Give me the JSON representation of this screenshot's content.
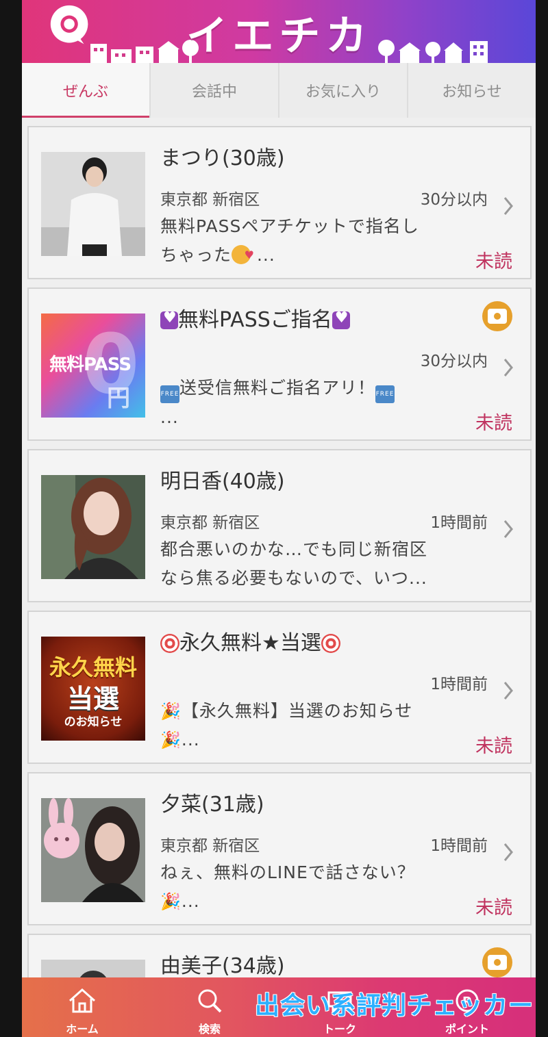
{
  "app": {
    "title": "イエチカ"
  },
  "tabs": [
    {
      "label": "ぜんぶ",
      "active": true
    },
    {
      "label": "会話中",
      "active": false
    },
    {
      "label": "お気に入り",
      "active": false
    },
    {
      "label": "お知らせ",
      "active": false
    }
  ],
  "messages": [
    {
      "name": "まつり(30歳)",
      "location": "東京都 新宿区",
      "time": "30分以内",
      "preview_line1": "無料PASSペアチケットで指名し",
      "preview_line2": "ちゃった",
      "preview_suffix": " ...",
      "status": "未読",
      "has_camera": false
    },
    {
      "name": "無料PASSご指名",
      "location": "",
      "time": "30分以内",
      "preview_line1": "送受信無料ご指名アリ！",
      "preview_line2": "...",
      "status": "未読",
      "has_camera": true,
      "thumb_text_main": "無料PASS",
      "thumb_text_big": "0",
      "thumb_text_yen": "円"
    },
    {
      "name": "明日香(40歳)",
      "location": "東京都 新宿区",
      "time": "1時間前",
      "preview_line1": "都合悪いのかな…でも同じ新宿区",
      "preview_line2": "なら焦る必要もないので、いつ...",
      "status": "",
      "has_camera": false
    },
    {
      "name": "永久無料★当選",
      "location": "",
      "time": "1時間前",
      "preview_line1": "【永久無料】当選のお知らせ",
      "preview_line2": "...",
      "status": "未読",
      "has_camera": false,
      "thumb_text_top": "永久無料",
      "thumb_text_mid": "当選",
      "thumb_text_bottom": "のお知らせ"
    },
    {
      "name": "夕菜(31歳)",
      "location": "東京都 新宿区",
      "time": "1時間前",
      "preview_line1": "ねぇ、無料のLINEで話さない？",
      "preview_line2": "...",
      "status": "未読",
      "has_camera": false
    },
    {
      "name": "由美子(34歳)",
      "location": "",
      "time": "",
      "preview_line1": "",
      "preview_line2": "",
      "status": "",
      "has_camera": true
    }
  ],
  "bottom_nav": [
    {
      "label": "ホーム",
      "icon": "home-icon"
    },
    {
      "label": "検索",
      "icon": "search-icon"
    },
    {
      "label": "トーク",
      "icon": "talk-icon"
    },
    {
      "label": "ポイント",
      "icon": "point-icon"
    }
  ],
  "watermark": "出会い系評判チェッカー",
  "colors": {
    "accent": "#c0335f",
    "camera": "#e6a02c",
    "watermark": "#2eb0ff"
  }
}
